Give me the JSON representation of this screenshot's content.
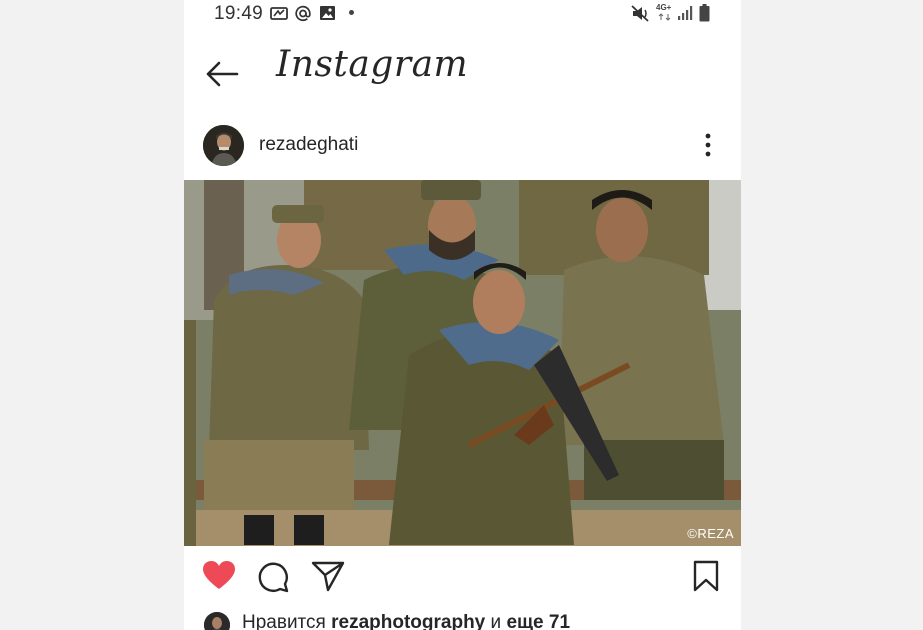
{
  "status_bar": {
    "time": "19:49",
    "network": "4G+",
    "left_icons": [
      "voicemail-icon",
      "at-icon",
      "image-icon"
    ],
    "right_icons": [
      "mute-icon",
      "signal-icon",
      "battery-icon"
    ]
  },
  "header": {
    "app_title": "Instagram",
    "back_icon": "arrow-left-icon"
  },
  "post": {
    "username": "rezadeghati",
    "watermark": "©REZA",
    "more_icon": "more-vertical-icon"
  },
  "actions": {
    "like_icon": "heart-filled-icon",
    "like_color": "#ed4956",
    "comment_icon": "comment-icon",
    "share_icon": "send-icon",
    "save_icon": "bookmark-icon"
  },
  "likes": {
    "prefix": "Нравится",
    "user": "rezaphotography",
    "conjunction": "и",
    "others": "еще 71"
  }
}
